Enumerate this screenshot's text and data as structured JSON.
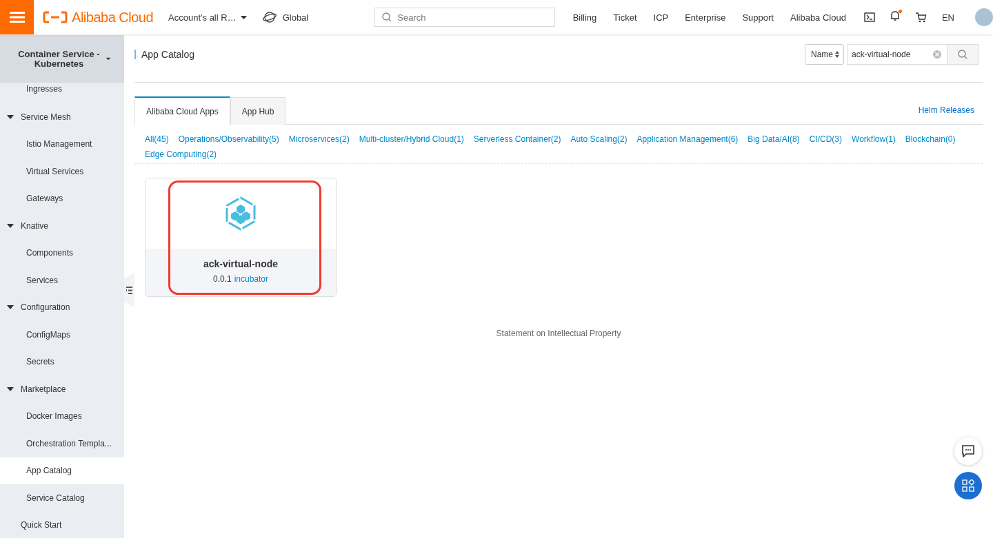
{
  "header": {
    "brand": "Alibaba Cloud",
    "account": "Account's all R…",
    "region": "Global",
    "search": {
      "placeholder": "Search"
    },
    "nav": [
      "Billing",
      "Ticket",
      "ICP",
      "Enterprise",
      "Support",
      "Alibaba Cloud"
    ],
    "language": "EN",
    "notification_dot": true
  },
  "sidebar": {
    "title": "Container Service - Kubernetes",
    "overflow_children": [
      {
        "label": "Ingresses",
        "selected": false
      }
    ],
    "items": [
      {
        "label": "Service Mesh",
        "expanded": true,
        "selected": false,
        "children": [
          {
            "label": "Istio Management",
            "selected": false
          },
          {
            "label": "Virtual Services",
            "selected": false
          },
          {
            "label": "Gateways",
            "selected": false
          }
        ]
      },
      {
        "label": "Knative",
        "expanded": true,
        "selected": false,
        "children": [
          {
            "label": "Components",
            "selected": false
          },
          {
            "label": "Services",
            "selected": false
          }
        ]
      },
      {
        "label": "Configuration",
        "expanded": true,
        "selected": false,
        "children": [
          {
            "label": "ConfigMaps",
            "selected": false
          },
          {
            "label": "Secrets",
            "selected": false
          }
        ]
      },
      {
        "label": "Marketplace",
        "expanded": true,
        "selected": false,
        "children": [
          {
            "label": "Docker Images",
            "selected": false
          },
          {
            "label": "Orchestration Templa...",
            "selected": false
          },
          {
            "label": "App Catalog",
            "selected": true
          },
          {
            "label": "Service Catalog",
            "selected": false
          }
        ]
      },
      {
        "label": "Quick Start",
        "selected": false
      }
    ]
  },
  "page": {
    "title": "App Catalog",
    "filter": {
      "field": "Name",
      "value": "ack-virtual-node"
    },
    "tabs": [
      {
        "label": "Alibaba Cloud Apps",
        "selected": true
      },
      {
        "label": "App Hub",
        "selected": false
      }
    ],
    "helm_link": "Helm Releases",
    "categories": [
      "All(45)",
      "Operations/Observability(5)",
      "Microservices(2)",
      "Multi-cluster/Hybrid Cloud(1)",
      "Serverless Container(2)",
      "Auto Scaling(2)",
      "Application Management(6)",
      "Big Data/AI(8)",
      "CI/CD(3)",
      "Workflow(1)",
      "Blockchain(0)",
      "Edge Computing(2)"
    ],
    "cards": [
      {
        "name": "ack-virtual-node",
        "version": "0.0.1",
        "tag": "incubator",
        "highlighted": true
      }
    ],
    "footer": "Statement on Intellectual Property"
  }
}
